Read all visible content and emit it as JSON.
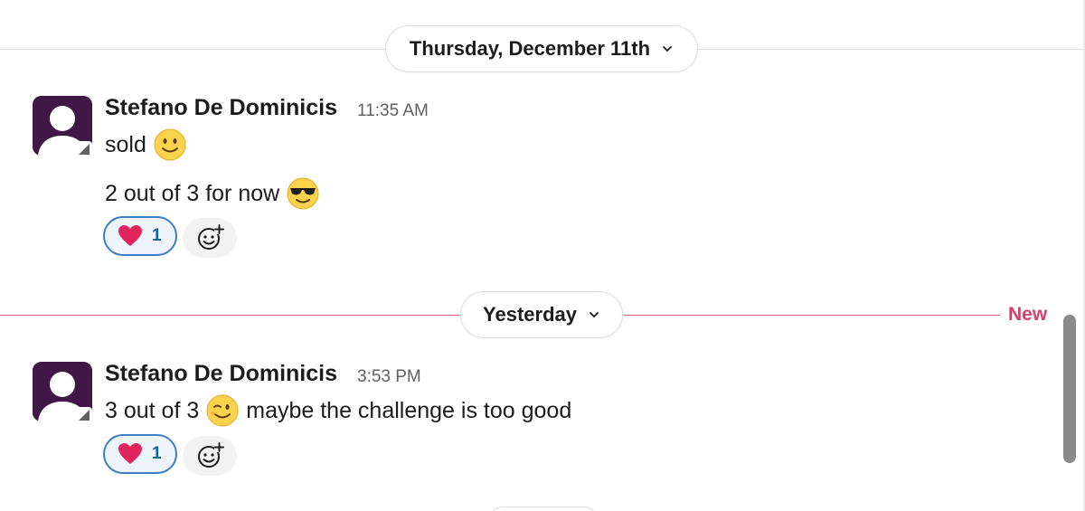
{
  "dividers": [
    {
      "label": "Thursday, December 11th",
      "chevron": "chevron-down-icon"
    },
    {
      "label": "Yesterday",
      "chevron": "chevron-down-icon",
      "new_label": "New"
    }
  ],
  "messages": [
    {
      "sender": "Stefano De Dominicis",
      "time": "11:35 AM",
      "lines": [
        {
          "text": "sold",
          "emoji": "slightly-smiling-face"
        },
        {
          "text": "2 out of 3 for now",
          "emoji": "smiling-face-with-sunglasses"
        }
      ],
      "reaction": {
        "emoji": "red-heart",
        "count": "1"
      }
    },
    {
      "sender": "Stefano De Dominicis",
      "time": "3:53 PM",
      "lines": [
        {
          "text_before": "3 out of 3",
          "emoji": "winking-face",
          "text_after": "maybe the challenge is too good"
        }
      ],
      "reaction": {
        "emoji": "red-heart",
        "count": "1"
      }
    }
  ],
  "colors": {
    "avatar_bg": "#3f1845",
    "new_line": "#e0607e",
    "new_label": "#d0436a",
    "reaction_border": "#3d7ec5",
    "reaction_count": "#1264a3"
  }
}
